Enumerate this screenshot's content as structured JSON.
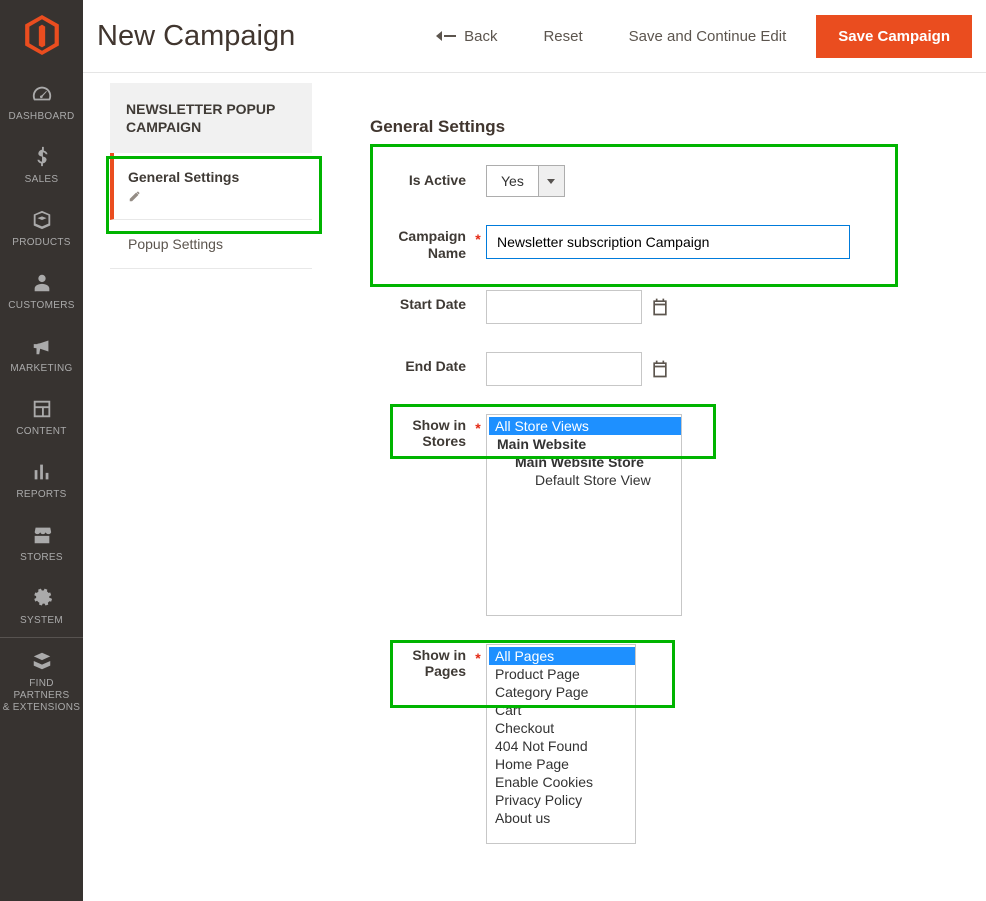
{
  "page_title": "New Campaign",
  "topbar": {
    "back": "Back",
    "reset": "Reset",
    "save_continue": "Save and Continue Edit",
    "save": "Save Campaign"
  },
  "admin_nav": {
    "dashboard": "DASHBOARD",
    "sales": "SALES",
    "products": "PRODUCTS",
    "customers": "CUSTOMERS",
    "marketing": "MARKETING",
    "content": "CONTENT",
    "reports": "REPORTS",
    "stores": "STORES",
    "system": "SYSTEM",
    "extensions_1": "FIND PARTNERS",
    "extensions_2": "& EXTENSIONS"
  },
  "side_panel": {
    "heading_1": "NEWSLETTER POPUP",
    "heading_2": "CAMPAIGN",
    "tab_general": "General Settings",
    "tab_popup": "Popup Settings"
  },
  "section": {
    "title": "General Settings"
  },
  "fields": {
    "is_active_lbl": "Is Active",
    "is_active_val": "Yes",
    "campaign_name_lbl_1": "Campaign",
    "campaign_name_lbl_2": "Name",
    "campaign_name_val": "Newsletter subscription Campaign",
    "start_date_lbl": "Start Date",
    "start_date_val": "",
    "end_date_lbl": "End Date",
    "end_date_val": "",
    "show_stores_lbl_1": "Show in",
    "show_stores_lbl_2": "Stores",
    "show_pages_lbl_1": "Show in",
    "show_pages_lbl_2": "Pages"
  },
  "stores_options": [
    {
      "label": "All Store Views",
      "indent": 0,
      "selected": true
    },
    {
      "label": "Main Website",
      "indent": 1,
      "selected": false
    },
    {
      "label": "Main Website Store",
      "indent": 2,
      "selected": false
    },
    {
      "label": "Default Store View",
      "indent": 3,
      "selected": false
    }
  ],
  "pages_options": [
    {
      "label": "All Pages",
      "selected": true
    },
    {
      "label": "Product Page",
      "selected": false
    },
    {
      "label": "Category Page",
      "selected": false
    },
    {
      "label": "Cart",
      "selected": false
    },
    {
      "label": "Checkout",
      "selected": false
    },
    {
      "label": "404 Not Found",
      "selected": false
    },
    {
      "label": "Home Page",
      "selected": false
    },
    {
      "label": "Enable Cookies",
      "selected": false
    },
    {
      "label": "Privacy Policy",
      "selected": false
    },
    {
      "label": "About us",
      "selected": false
    }
  ]
}
